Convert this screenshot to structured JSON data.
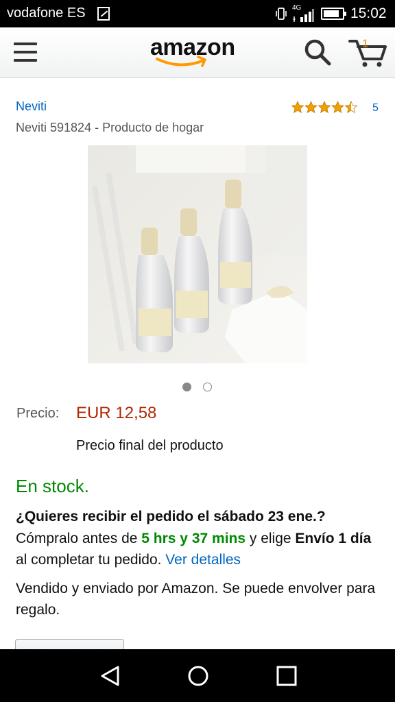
{
  "status_bar": {
    "carrier": "vodafone ES",
    "network": "4G",
    "time": "15:02"
  },
  "header": {
    "logo_text": "amazon",
    "cart_count": "1",
    "icons": [
      "menu-icon",
      "search-icon",
      "cart-icon"
    ]
  },
  "product": {
    "brand": "Neviti",
    "title": "Neviti 591824 - Producto de hogar",
    "rating_stars": 4.5,
    "review_count": "5",
    "image_count": 2,
    "active_image": 1
  },
  "pricing": {
    "label": "Precio:",
    "value": "EUR 12,58",
    "note": "Precio final del producto"
  },
  "availability": {
    "stock": "En stock.",
    "delivery_question": "¿Quieres recibir el pedido el sábado 23 ene.?",
    "order_prefix": "Cómpralo antes de ",
    "countdown": "5 hrs y 37 mins",
    "order_middle": " y elige ",
    "shipping_option": "Envío 1 día",
    "order_suffix": " al completar tu pedido. ",
    "details_link": "Ver detalles",
    "seller_info": "Vendido y enviado por Amazon. Se puede envolver para regalo."
  },
  "colors": {
    "link": "#0066c0",
    "price": "#b12704",
    "stock": "#008a00",
    "star": "#f0a000",
    "cart_accent": "#f08804"
  },
  "nav_bar": {
    "icons": [
      "back-icon",
      "home-icon",
      "recent-apps-icon"
    ]
  }
}
